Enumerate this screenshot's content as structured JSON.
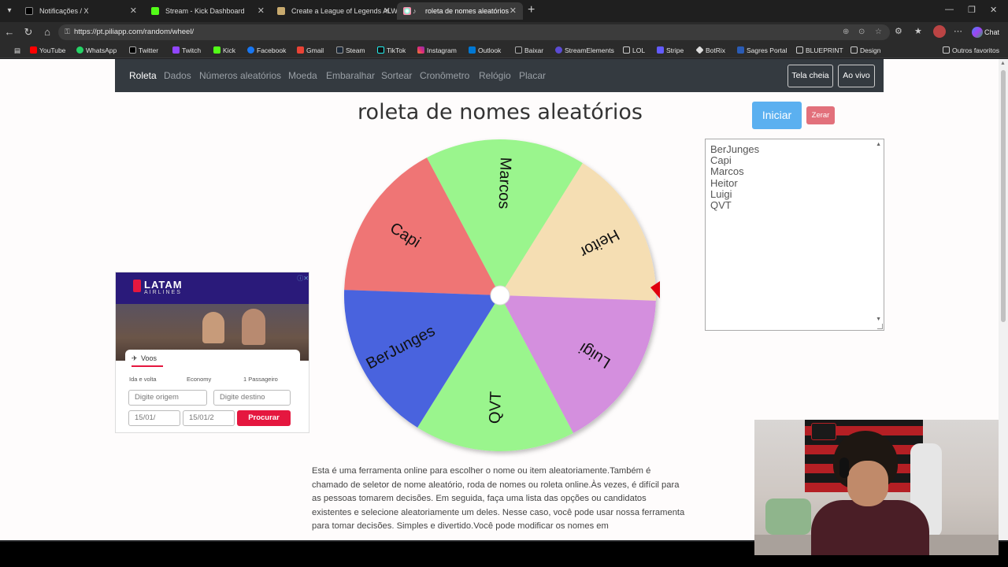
{
  "browser": {
    "tabs": [
      {
        "label": "Notificações / X",
        "active": false
      },
      {
        "label": "Stream - Kick Dashboard",
        "active": false
      },
      {
        "label": "Create a League of Legends ALWA",
        "active": false
      },
      {
        "label": "roleta de nomes aleatórios",
        "active": true
      }
    ],
    "url": "https://pt.piliapp.com/random/wheel/",
    "chat_label": "Chat",
    "bookmarks": [
      "YouTube",
      "WhatsApp",
      "Twitter",
      "Twitch",
      "Kick",
      "Facebook",
      "Gmail",
      "Steam",
      "TikTok",
      "Instagram",
      "Outlook",
      "Baixar",
      "StreamElements",
      "LOL",
      "Stripe",
      "BotRix",
      "Sagres Portal",
      "BLUEPRINT",
      "Design"
    ],
    "other_bookmarks": "Outros favoritos"
  },
  "nav": {
    "items": [
      "Roleta",
      "Dados",
      "Números aleatórios",
      "Moeda",
      "Embaralhar",
      "Sortear",
      "Cronômetro",
      "Relógio",
      "Placar"
    ],
    "fullscreen": "Tela cheia",
    "live": "Ao vivo"
  },
  "page": {
    "title": "roleta de nomes aleatórios",
    "start_label": "Iniciar",
    "reset_label": "Zerar",
    "names": [
      "BerJunges",
      "Capi",
      "Marcos",
      "Heitor",
      "Luigi",
      "QVT"
    ],
    "description": "Esta é uma ferramenta online para escolher o nome ou item aleatoriamente.Também é chamado de seletor de nome aleatório, roda de nomes ou roleta online.Às vezes, é difícil para as pessoas tomarem decisões. Em seguida, faça uma lista das opções ou candidatos existentes e selecione aleatoriamente um deles. Nesse caso, você pode usar nossa ferramenta para tomar decisões. Simples e divertido.Você pode modificar os nomes em"
  },
  "wheel": {
    "segments": [
      {
        "name": "Capi",
        "color": "#ef7575"
      },
      {
        "name": "Marcos",
        "color": "#9af58d"
      },
      {
        "name": "Heitor",
        "color": "#f5deb3"
      },
      {
        "name": "Luigi",
        "color": "#d48fde"
      },
      {
        "name": "QVT",
        "color": "#9af58d"
      },
      {
        "name": "BerJunges",
        "color": "#4a63de"
      }
    ],
    "pointer_color": "#e0000e"
  },
  "ad": {
    "brand": "LATAM",
    "brand_sub": "AIRLINES",
    "tab": "Voos",
    "trip": "Ida e volta",
    "cabin": "Economy",
    "passengers": "1 Passageiro",
    "origin_placeholder": "Digite origem",
    "dest_placeholder": "Digite destino",
    "date1": "15/01/",
    "date2": "15/01/2",
    "search": "Procurar"
  }
}
